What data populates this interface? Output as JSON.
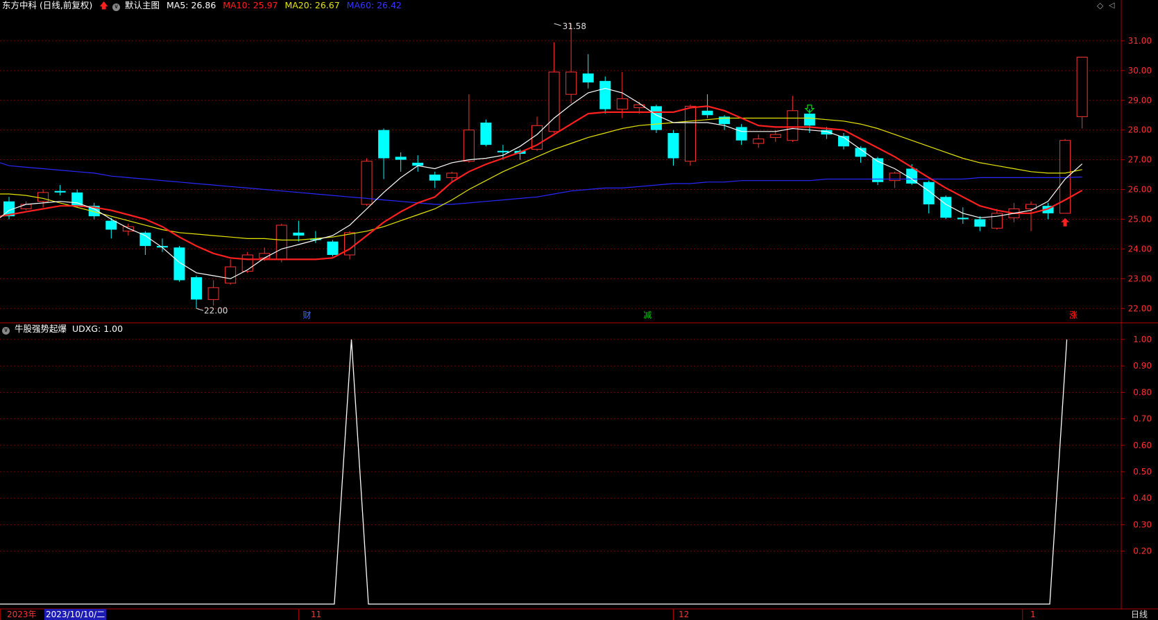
{
  "main_header": {
    "title": "东方中科 (日线,前复权)",
    "indicator_name": "默认主图",
    "ma5_label": "MA5: 26.86",
    "ma10_label": "MA10: 25.97",
    "ma20_label": "MA20: 26.67",
    "ma60_label": "MA60: 26.42"
  },
  "sub_header": {
    "title": "牛股强势起爆",
    "value_label": "UDXG: 1.00"
  },
  "time_bar": {
    "year_label": "2023年",
    "cursor_date": "2023/10/10/二",
    "period_button": "日线",
    "month_labels": [
      "11",
      "12",
      "1"
    ]
  },
  "colors": {
    "up": "#ff3232",
    "down": "#00ffff",
    "ma5": "#ffffff",
    "ma10": "#ff2020",
    "ma20": "#e6e600",
    "ma60": "#2828ff",
    "axis": "#b40000",
    "grid": "#7a0000",
    "indicator": "#ffffff"
  },
  "chart_data": [
    {
      "type": "candlestick",
      "title": "东方中科 (日线,前复权)",
      "ylim": [
        21.5,
        31.5
      ],
      "y_ticks": [
        "31.00",
        "30.00",
        "29.00",
        "28.00",
        "27.00",
        "26.00",
        "25.00",
        "24.00",
        "23.00",
        "22.00"
      ],
      "y_tick_values": [
        31,
        30,
        29,
        28,
        27,
        26,
        25,
        24,
        23,
        22
      ],
      "x_axis_labels": [
        "2023年",
        "11",
        "12",
        "1"
      ],
      "annotations": {
        "max_label": "31.58",
        "max_value": 31.58,
        "max_index": 32,
        "min_label": "22.00",
        "min_value": 22.0,
        "min_index": 11,
        "event_markers": [
          {
            "index": 17,
            "label": "财",
            "color": "#3f6fff"
          },
          {
            "index": 37,
            "label": "减",
            "color": "#00cc00"
          },
          {
            "index": 62,
            "label": "涨",
            "color": "#ff2020"
          }
        ],
        "signal_arrows": [
          {
            "index": 47,
            "direction": "down",
            "color": "#00dd00",
            "value": 28.7
          },
          {
            "index": 62,
            "direction": "up",
            "color": "#ff2020",
            "value": 24.9
          }
        ]
      },
      "candles": [
        [
          25.6,
          25.1,
          25.75,
          25.0
        ],
        [
          25.35,
          25.5,
          25.6,
          25.3
        ],
        [
          25.6,
          25.9,
          26.0,
          25.4
        ],
        [
          25.95,
          25.9,
          26.15,
          25.8
        ],
        [
          25.9,
          25.45,
          26.0,
          25.4
        ],
        [
          25.45,
          25.1,
          25.55,
          25.0
        ],
        [
          24.95,
          24.65,
          25.05,
          24.35
        ],
        [
          24.6,
          24.75,
          24.85,
          24.45
        ],
        [
          24.55,
          24.1,
          24.6,
          23.8
        ],
        [
          24.1,
          24.05,
          24.35,
          23.9
        ],
        [
          24.05,
          22.95,
          24.1,
          22.9
        ],
        [
          23.05,
          22.3,
          23.1,
          22.0
        ],
        [
          22.3,
          22.7,
          22.95,
          22.1
        ],
        [
          22.85,
          23.4,
          23.65,
          22.8
        ],
        [
          23.25,
          23.8,
          23.9,
          23.2
        ],
        [
          23.7,
          23.85,
          24.05,
          23.6
        ],
        [
          23.65,
          24.8,
          24.85,
          23.55
        ],
        [
          24.55,
          24.45,
          24.95,
          24.25
        ],
        [
          24.35,
          24.3,
          24.6,
          24.2
        ],
        [
          24.25,
          23.8,
          24.3,
          23.75
        ],
        [
          23.8,
          24.55,
          24.6,
          23.65
        ],
        [
          25.5,
          26.95,
          27.05,
          25.45
        ],
        [
          28.0,
          27.05,
          28.05,
          26.35
        ],
        [
          27.1,
          27.0,
          27.25,
          26.6
        ],
        [
          26.9,
          26.8,
          27.15,
          26.6
        ],
        [
          26.5,
          26.3,
          26.6,
          26.05
        ],
        [
          26.4,
          26.55,
          26.6,
          26.25
        ],
        [
          26.95,
          28.0,
          29.2,
          26.9
        ],
        [
          28.25,
          27.5,
          28.35,
          27.45
        ],
        [
          27.3,
          27.25,
          27.5,
          27.0
        ],
        [
          27.3,
          27.2,
          27.35,
          27.0
        ],
        [
          27.35,
          28.15,
          28.45,
          27.3
        ],
        [
          27.95,
          29.95,
          30.95,
          27.9
        ],
        [
          29.2,
          29.95,
          31.58,
          28.9
        ],
        [
          29.9,
          29.6,
          30.55,
          29.4
        ],
        [
          29.65,
          28.7,
          29.8,
          28.55
        ],
        [
          28.7,
          29.05,
          29.95,
          28.4
        ],
        [
          28.75,
          28.85,
          28.95,
          28.55
        ],
        [
          28.8,
          28.0,
          28.85,
          27.9
        ],
        [
          27.9,
          27.05,
          28.0,
          26.8
        ],
        [
          26.95,
          28.8,
          28.85,
          26.8
        ],
        [
          28.65,
          28.5,
          29.2,
          28.4
        ],
        [
          28.45,
          28.2,
          28.5,
          28.0
        ],
        [
          28.1,
          27.65,
          28.2,
          27.5
        ],
        [
          27.55,
          27.7,
          27.85,
          27.4
        ],
        [
          27.75,
          27.85,
          28.0,
          27.6
        ],
        [
          27.65,
          28.65,
          29.15,
          27.6
        ],
        [
          28.55,
          28.15,
          28.7,
          27.9
        ],
        [
          28.0,
          27.85,
          28.1,
          27.7
        ],
        [
          27.8,
          27.45,
          27.9,
          27.35
        ],
        [
          27.4,
          27.1,
          27.45,
          26.9
        ],
        [
          27.05,
          26.25,
          27.1,
          26.15
        ],
        [
          26.3,
          26.55,
          26.6,
          26.05
        ],
        [
          26.7,
          26.2,
          26.85,
          26.15
        ],
        [
          26.25,
          25.5,
          26.3,
          25.2
        ],
        [
          25.75,
          25.05,
          25.8,
          25.0
        ],
        [
          25.05,
          25.0,
          25.4,
          24.85
        ],
        [
          25.0,
          24.75,
          25.1,
          24.6
        ],
        [
          24.7,
          25.2,
          25.35,
          24.65
        ],
        [
          25.05,
          25.35,
          25.55,
          24.9
        ],
        [
          25.35,
          25.5,
          25.6,
          24.6
        ],
        [
          25.45,
          25.2,
          25.55,
          25.0
        ],
        [
          25.2,
          27.65,
          27.7,
          25.2
        ],
        [
          28.45,
          30.45,
          30.45,
          28.05
        ]
      ],
      "series": [
        {
          "name": "MA5",
          "values": [
            25.05,
            25.3,
            25.5,
            25.55,
            25.6,
            25.55,
            25.35,
            25.0,
            24.7,
            24.45,
            24.05,
            23.55,
            23.2,
            23.1,
            23.0,
            23.3,
            23.7,
            24.0,
            24.15,
            24.3,
            24.45,
            24.8,
            25.35,
            25.9,
            26.4,
            26.8,
            26.7,
            26.9,
            27.0,
            27.05,
            27.15,
            27.45,
            27.85,
            28.4,
            28.85,
            29.25,
            29.4,
            29.25,
            28.9,
            28.5,
            28.25,
            28.25,
            28.25,
            28.15,
            27.95,
            27.95,
            27.95,
            28.05,
            28.0,
            27.95,
            27.75,
            27.35,
            26.95,
            26.7,
            26.35,
            25.95,
            25.5,
            25.2,
            25.05,
            25.1,
            25.2,
            25.3,
            25.6,
            26.35,
            26.86
          ]
        },
        {
          "name": "MA10",
          "values": [
            25.1,
            25.15,
            25.25,
            25.35,
            25.45,
            25.45,
            25.4,
            25.3,
            25.15,
            25.0,
            24.75,
            24.4,
            24.1,
            23.85,
            23.7,
            23.65,
            23.65,
            23.65,
            23.65,
            23.65,
            23.7,
            24.0,
            24.45,
            24.9,
            25.25,
            25.55,
            25.75,
            26.25,
            26.6,
            26.85,
            27.05,
            27.25,
            27.5,
            27.85,
            28.2,
            28.55,
            28.6,
            28.6,
            28.6,
            28.6,
            28.6,
            28.75,
            28.8,
            28.65,
            28.4,
            28.15,
            28.1,
            28.1,
            28.1,
            28.05,
            28.0,
            27.7,
            27.4,
            27.1,
            26.75,
            26.4,
            26.05,
            25.75,
            25.45,
            25.3,
            25.2,
            25.2,
            25.35,
            25.65,
            25.97
          ]
        },
        {
          "name": "MA20",
          "values": [
            25.85,
            25.85,
            25.8,
            25.7,
            25.55,
            25.4,
            25.25,
            25.1,
            24.95,
            24.8,
            24.65,
            24.55,
            24.5,
            24.45,
            24.4,
            24.35,
            24.35,
            24.3,
            24.3,
            24.35,
            24.4,
            24.5,
            24.6,
            24.75,
            24.95,
            25.15,
            25.35,
            25.65,
            26.0,
            26.3,
            26.6,
            26.85,
            27.1,
            27.35,
            27.55,
            27.75,
            27.9,
            28.05,
            28.15,
            28.2,
            28.25,
            28.3,
            28.35,
            28.4,
            28.4,
            28.4,
            28.4,
            28.4,
            28.4,
            28.35,
            28.3,
            28.2,
            28.05,
            27.85,
            27.65,
            27.45,
            27.25,
            27.05,
            26.9,
            26.8,
            26.7,
            26.6,
            26.55,
            26.55,
            26.67
          ]
        },
        {
          "name": "MA60",
          "values": [
            26.9,
            26.8,
            26.75,
            26.7,
            26.65,
            26.6,
            26.55,
            26.45,
            26.4,
            26.35,
            26.3,
            26.25,
            26.2,
            26.15,
            26.1,
            26.05,
            26.0,
            25.95,
            25.9,
            25.85,
            25.8,
            25.75,
            25.7,
            25.65,
            25.6,
            25.55,
            25.5,
            25.5,
            25.55,
            25.6,
            25.65,
            25.7,
            25.75,
            25.85,
            25.95,
            26.0,
            26.05,
            26.05,
            26.1,
            26.15,
            26.2,
            26.2,
            26.25,
            26.25,
            26.3,
            26.3,
            26.3,
            26.3,
            26.3,
            26.35,
            26.35,
            26.35,
            26.35,
            26.35,
            26.35,
            26.35,
            26.35,
            26.35,
            26.4,
            26.4,
            26.4,
            26.4,
            26.4,
            26.4,
            26.42
          ]
        }
      ]
    },
    {
      "type": "line",
      "title": "牛股强势起爆",
      "ylim": [
        0,
        1.05
      ],
      "y_ticks": [
        "1.00",
        "0.90",
        "0.80",
        "0.70",
        "0.60",
        "0.50",
        "0.40",
        "0.30",
        "0.20"
      ],
      "y_tick_values": [
        1.0,
        0.9,
        0.8,
        0.7,
        0.6,
        0.5,
        0.4,
        0.3,
        0.2
      ],
      "series": [
        {
          "name": "UDXG",
          "values": [
            0,
            0,
            0,
            0,
            0,
            0,
            0,
            0,
            0,
            0,
            0,
            0,
            0,
            0,
            0,
            0,
            0,
            0,
            0,
            0,
            0,
            1,
            0,
            0,
            0,
            0,
            0,
            0,
            0,
            0,
            0,
            0,
            0,
            0,
            0,
            0,
            0,
            0,
            0,
            0,
            0,
            0,
            0,
            0,
            0,
            0,
            0,
            0,
            0,
            0,
            0,
            0,
            0,
            0,
            0,
            0,
            0,
            0,
            0,
            0,
            0,
            0,
            0,
            1
          ]
        }
      ]
    }
  ]
}
